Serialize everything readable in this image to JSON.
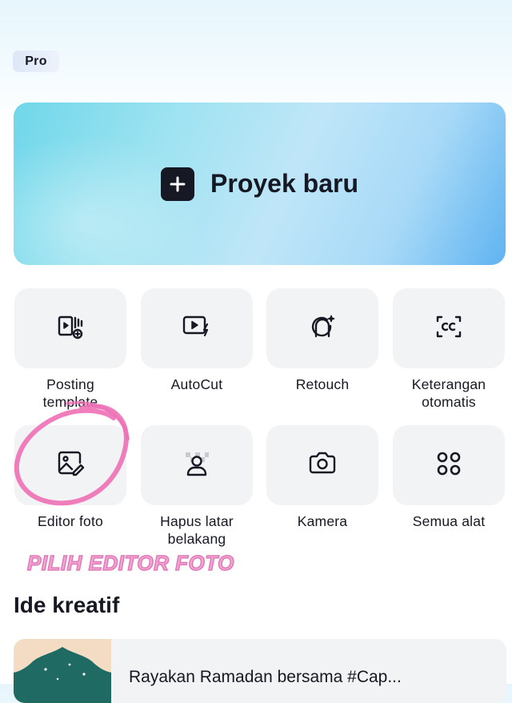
{
  "header": {
    "pro_badge": "Pro"
  },
  "hero": {
    "label": "Proyek baru",
    "icon": "plus-icon"
  },
  "tools": [
    {
      "label": "Posting\ntemplate",
      "icon": "template-post-icon"
    },
    {
      "label": "AutoCut",
      "icon": "autocut-icon"
    },
    {
      "label": "Retouch",
      "icon": "retouch-icon"
    },
    {
      "label": "Keterangan\notomatis",
      "icon": "captions-icon"
    },
    {
      "label": "Editor foto",
      "icon": "photo-editor-icon"
    },
    {
      "label": "Hapus latar\nbelakang",
      "icon": "remove-background-icon"
    },
    {
      "label": "Kamera",
      "icon": "camera-icon"
    },
    {
      "label": "Semua alat",
      "icon": "all-tools-icon"
    }
  ],
  "annotation": {
    "text": "PILIH EDITOR FOTO",
    "color": "#e07ab8"
  },
  "ideas": {
    "section_title": "Ide kreatif",
    "items": [
      {
        "title": "Rayakan Ramadan bersama #Cap..."
      }
    ]
  }
}
